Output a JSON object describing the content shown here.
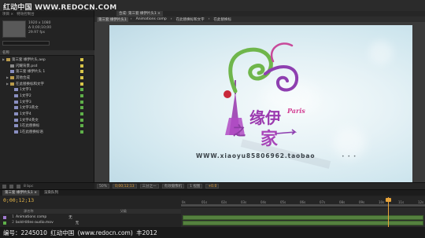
{
  "watermark": {
    "top": "红动中国 WWW.REDOCN.COM",
    "bottom": "编号：2245010    红动中国 (www.redocn.com)    丰2012"
  },
  "project_panel": {
    "tabs": [
      "项目 ×",
      "特效控制台"
    ],
    "thumbnail_info": [
      "1920 x 1080",
      "Δ 0;00;10;00",
      "29.97 fps"
    ],
    "column_header": "名称",
    "items": [
      {
        "label": "第三套 缘伊片头.aep",
        "indent": 0,
        "type": "folder",
        "swatch": "#d8c54a"
      },
      {
        "label": "闪耀背景.psd",
        "indent": 1,
        "type": "file",
        "swatch": "#d8c54a"
      },
      {
        "label": "第三套 缘伊片头 1",
        "indent": 1,
        "type": "comp",
        "swatch": "#d8c54a"
      },
      {
        "label": "其他合成",
        "indent": 1,
        "type": "folder",
        "swatch": "#d8c54a"
      },
      {
        "label": "在此替换标和文字",
        "indent": 1,
        "type": "folder",
        "swatch": "#d8c54a"
      },
      {
        "label": "1文字1",
        "indent": 2,
        "type": "comp",
        "swatch": "#5fb04a"
      },
      {
        "label": "1文字2",
        "indent": 2,
        "type": "comp",
        "swatch": "#5fb04a"
      },
      {
        "label": "1文字3",
        "indent": 2,
        "type": "comp",
        "swatch": "#5fb04a"
      },
      {
        "label": "1文字3英文",
        "indent": 2,
        "type": "comp",
        "swatch": "#5fb04a"
      },
      {
        "label": "1文字4",
        "indent": 2,
        "type": "comp",
        "swatch": "#5fb04a"
      },
      {
        "label": "1文字4英文",
        "indent": 2,
        "type": "comp",
        "swatch": "#5fb04a"
      },
      {
        "label": "1在此替换标",
        "indent": 2,
        "type": "comp",
        "swatch": "#5fb04a"
      },
      {
        "label": "1在此替换标语",
        "indent": 2,
        "type": "comp",
        "swatch": "#5fb04a"
      }
    ],
    "footer_label": "8 bpc"
  },
  "viewer": {
    "tab_label": "合成: 第三套 缘伊片头1 ×",
    "breadcrumbs": [
      "第三套 缘伊片头1",
      "Animations comp",
      "在此替换标和文字",
      "在此替换标"
    ],
    "canvas_text": "WWW.xiaoyu85806962.taobao",
    "canvas_dots": "• • •",
    "logo_script": "Paris",
    "logo_chars": "缘伊 之 家",
    "controls": [
      "50%",
      "0;00;12;13",
      "三分之一",
      "有效摄像机",
      "1 视图",
      "+0.0"
    ]
  },
  "timeline": {
    "tabs": [
      "第三套 缘伊片头1 ×",
      "渲染队列"
    ],
    "timecode": "0;00;12;13",
    "column_headers": [
      "源名称",
      "父级"
    ],
    "layers": [
      {
        "num": "1",
        "name": "Animations comp",
        "color": "#a07ad0",
        "parent": "无"
      },
      {
        "num": "2",
        "name": "bold-titles-audio.mov",
        "color": "#5fb04a",
        "parent": "无"
      }
    ],
    "ruler_ticks": [
      "0s",
      "01s",
      "02s",
      "03s",
      "04s",
      "05s",
      "06s",
      "07s",
      "08s",
      "09s",
      "10s",
      "11s",
      "12s"
    ]
  },
  "colors": {
    "accent": "#e8a43a",
    "layer_bar": "#55813f"
  }
}
